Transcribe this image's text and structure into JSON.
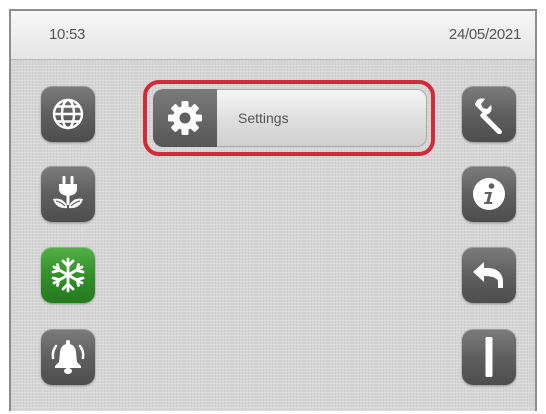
{
  "status_bar": {
    "time": "10:53",
    "date": "24/05/2021"
  },
  "left_nav": [
    {
      "name": "globe-icon",
      "active": false
    },
    {
      "name": "plug-leaf-icon",
      "active": false
    },
    {
      "name": "snowflake-icon",
      "active": true
    },
    {
      "name": "alarm-bell-icon",
      "active": false
    }
  ],
  "right_nav": [
    {
      "name": "wrench-icon"
    },
    {
      "name": "info-icon"
    },
    {
      "name": "back-arrow-icon"
    },
    {
      "name": "power-bar-icon"
    }
  ],
  "menu": {
    "items": [
      {
        "label": "Settings",
        "icon": "gear-icon",
        "highlighted": true
      }
    ]
  },
  "colors": {
    "highlight_border": "#d42a37",
    "active_tile": "#33902a",
    "tile": "#5f5f5f"
  }
}
